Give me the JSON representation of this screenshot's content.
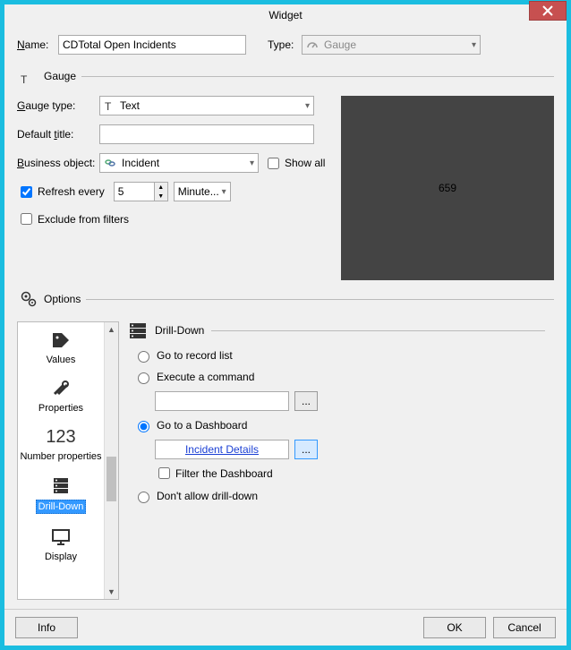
{
  "window": {
    "title": "Widget"
  },
  "header": {
    "name_label": "Name:",
    "name_value": "CDTotal Open Incidents",
    "type_label": "Type:",
    "type_value": "Gauge"
  },
  "gauge": {
    "section_label": "Gauge",
    "gauge_type_label": "Gauge type:",
    "gauge_type_value": "Text",
    "default_title_label": "Default title:",
    "default_title_value": "",
    "business_object_label": "Business object:",
    "business_object_value": "Incident",
    "show_all_label": "Show all",
    "refresh_label": "Refresh every",
    "refresh_value": "5",
    "refresh_unit": "Minute...",
    "exclude_label": "Exclude from filters",
    "preview_value": "659"
  },
  "options": {
    "section_label": "Options",
    "sidebar": [
      {
        "label": "Values"
      },
      {
        "label": "Properties"
      },
      {
        "label": "Number properties",
        "num": "123"
      },
      {
        "label": "Drill-Down"
      },
      {
        "label": "Display"
      }
    ],
    "drilldown": {
      "heading": "Drill-Down",
      "go_record_list": "Go to record list",
      "execute_command": "Execute a command",
      "command_value": "",
      "go_dashboard": "Go to a Dashboard",
      "dashboard_value": "Incident Details",
      "filter_dashboard": "Filter the Dashboard",
      "dont_allow": "Don't allow drill-down",
      "ellipsis": "..."
    }
  },
  "footer": {
    "info": "Info",
    "ok": "OK",
    "cancel": "Cancel"
  }
}
